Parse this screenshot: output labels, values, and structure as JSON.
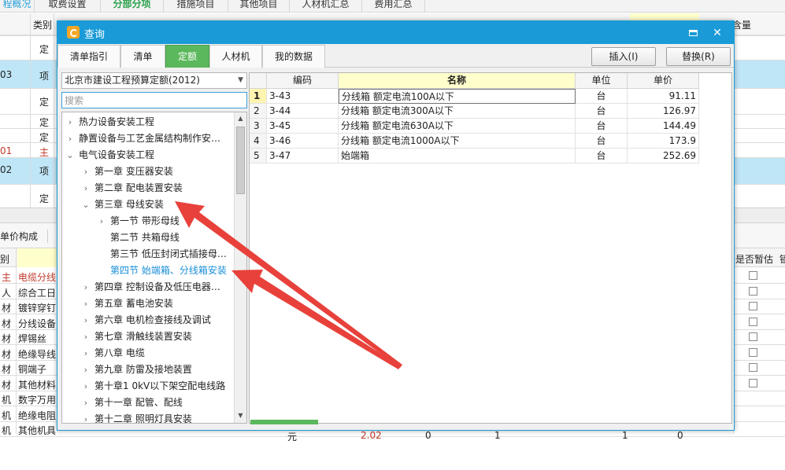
{
  "background": {
    "tabs": [
      "程概况",
      "取费设置",
      "分部分项",
      "措施项目",
      "其他项目",
      "人材机汇总",
      "费用汇总"
    ],
    "top_header": {
      "col_type": "类别",
      "col_right": "含量"
    },
    "rows_type": [
      "定",
      "项",
      "定",
      "定",
      "定",
      "主",
      "项",
      "定"
    ],
    "rows_code": [
      "03",
      "01",
      "02"
    ],
    "panel_label": "单价构成",
    "lower_header": {
      "col_type": "别",
      "col_right": "是否暂估",
      "col_extra": "锁"
    },
    "lower_types": [
      "主",
      "人",
      "材",
      "材",
      "材",
      "材",
      "材",
      "材",
      "机",
      "机",
      "机"
    ],
    "lower_names": [
      "电缆分线",
      "综合工日",
      "镀锌穿钉",
      "分线设备",
      "焊锡丝",
      "绝缘导线",
      "铜端子",
      "其他材料",
      "数字万用",
      "绝缘电阻",
      "其他机具费"
    ],
    "lower_partial": [
      "元",
      "2.02",
      "0",
      "1",
      "1",
      "0"
    ]
  },
  "dialog": {
    "title": "查询",
    "tabs": [
      {
        "label": "清单指引",
        "active": false
      },
      {
        "label": "清单",
        "active": false
      },
      {
        "label": "定额",
        "active": true
      },
      {
        "label": "人材机",
        "active": false
      },
      {
        "label": "我的数据",
        "active": false
      }
    ],
    "insert_button": "插入(I)",
    "replace_button": "替换(R)",
    "library_select": "北京市建设工程预算定额(2012)",
    "search_placeholder": "搜索",
    "tree": [
      {
        "label": "热力设备安装工程",
        "level": 0,
        "toggle": "›"
      },
      {
        "label": "静置设备与工艺金属结构制作安…",
        "level": 0,
        "toggle": "›"
      },
      {
        "label": "电气设备安装工程",
        "level": 0,
        "toggle": "⌄"
      },
      {
        "label": "第一章  变压器安装",
        "level": 1,
        "toggle": "›"
      },
      {
        "label": "第二章  配电装置安装",
        "level": 1,
        "toggle": "›"
      },
      {
        "label": "第三章  母线安装",
        "level": 1,
        "toggle": "⌄"
      },
      {
        "label": "第一节  带形母线",
        "level": 2,
        "toggle": "›"
      },
      {
        "label": "第二节  共箱母线",
        "level": 2,
        "toggle": ""
      },
      {
        "label": "第三节  低压封闭式插接母…",
        "level": 2,
        "toggle": ""
      },
      {
        "label": "第四节  始端箱、分线箱安装",
        "level": 2,
        "toggle": "",
        "selected": true
      },
      {
        "label": "第四章  控制设备及低压电器…",
        "level": 1,
        "toggle": "›"
      },
      {
        "label": "第五章  蓄电池安装",
        "level": 1,
        "toggle": "›"
      },
      {
        "label": "第六章  电机检查接线及调试",
        "level": 1,
        "toggle": "›"
      },
      {
        "label": "第七章  滑触线装置安装",
        "level": 1,
        "toggle": "›"
      },
      {
        "label": "第八章  电缆",
        "level": 1,
        "toggle": "›"
      },
      {
        "label": "第九章  防雷及接地装置",
        "level": 1,
        "toggle": "›"
      },
      {
        "label": "第十章1 0kV以下架空配电线路",
        "level": 1,
        "toggle": "›"
      },
      {
        "label": "第十一章  配管、配线",
        "level": 1,
        "toggle": "›"
      },
      {
        "label": "第十二章  照明灯具安装",
        "level": 1,
        "toggle": "›"
      }
    ],
    "table": {
      "headers": [
        "编码",
        "名称",
        "单位",
        "单价"
      ],
      "rows": [
        {
          "no": "1",
          "code": "3-43",
          "name": "分线箱 额定电流100A以下",
          "unit": "台",
          "price": "91.11"
        },
        {
          "no": "2",
          "code": "3-44",
          "name": "分线箱 额定电流300A以下",
          "unit": "台",
          "price": "126.97"
        },
        {
          "no": "3",
          "code": "3-45",
          "name": "分线箱 额定电流630A以下",
          "unit": "台",
          "price": "144.49"
        },
        {
          "no": "4",
          "code": "3-46",
          "name": "分线箱 额定电流1000A以下",
          "unit": "台",
          "price": "173.9"
        },
        {
          "no": "5",
          "code": "3-47",
          "name": "始端箱",
          "unit": "台",
          "price": "252.69"
        }
      ]
    }
  },
  "colors": {
    "accent": "#1a9bd7",
    "active_tab": "#5cb85c",
    "arrow": "#e8413b",
    "selection": "#1a8fd8"
  }
}
